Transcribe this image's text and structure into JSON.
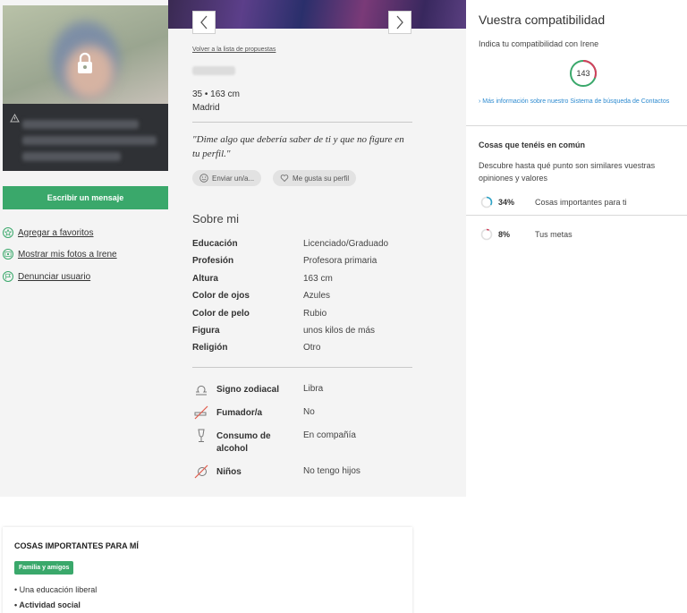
{
  "left": {
    "write_button": "Escribir un mensaje",
    "links": [
      {
        "label": "Agregar a favoritos",
        "icon": "star-icon"
      },
      {
        "label": "Mostrar mis fotos a Irene",
        "icon": "photo-icon"
      },
      {
        "label": "Denunciar usuario",
        "icon": "flag-icon"
      }
    ]
  },
  "profile": {
    "back_link": "Volver a la lista de propuestas",
    "age_height": "35 • 163 cm",
    "city": "Madrid",
    "quote": "\"Dime algo que debería saber de ti y que no figure en tu perfil.\"",
    "send_button": "Enviar un/a...",
    "like_button": "Me gusta su perfil",
    "about_title": "Sobre mi",
    "details": [
      {
        "label": "Educación",
        "value": "Licenciado/Graduado"
      },
      {
        "label": "Profesión",
        "value": "Profesora primaria"
      },
      {
        "label": "Altura",
        "value": "163 cm"
      },
      {
        "label": "Color de ojos",
        "value": "Azules"
      },
      {
        "label": "Color de pelo",
        "value": "Rubio"
      },
      {
        "label": "Figura",
        "value": "unos kilos de más"
      },
      {
        "label": "Religión",
        "value": "Otro"
      }
    ],
    "lifestyle": [
      {
        "label": "Signo zodiacal",
        "value": "Libra",
        "icon": "zodiac-libra-icon"
      },
      {
        "label": "Fumador/a",
        "value": "No",
        "icon": "no-smoking-icon"
      },
      {
        "label": "Consumo de alcohol",
        "value": "En compañía",
        "icon": "champagne-glass-icon"
      },
      {
        "label": "Niños",
        "value": "No tengo hijos",
        "icon": "no-children-icon"
      }
    ]
  },
  "compat": {
    "title": "Vuestra compatibilidad",
    "subtitle": "Indica tu compatibilidad con Irene",
    "score": "143",
    "more_info": "Más información sobre nuestro Sistema de búsqueda de Contactos",
    "common_title": "Cosas que tenéis en común",
    "common_desc": "Descubre hasta qué punto son similares vuestras opiniones y valores",
    "metrics": [
      {
        "pct": "34%",
        "fraction": 0.34,
        "label": "Cosas importantes para ti",
        "color": "#2ea3c7"
      },
      {
        "pct": "8%",
        "fraction": 0.08,
        "label": "Tus metas",
        "color": "#d2405c"
      }
    ]
  },
  "card": {
    "title": "COSAS IMPORTANTES PARA MÍ",
    "tag": "Familia y amigos",
    "items": [
      "• Una educación liberal",
      "• Actividad social"
    ]
  },
  "colors": {
    "accent_green": "#3aa86b",
    "link_blue": "#2e8bd0"
  }
}
